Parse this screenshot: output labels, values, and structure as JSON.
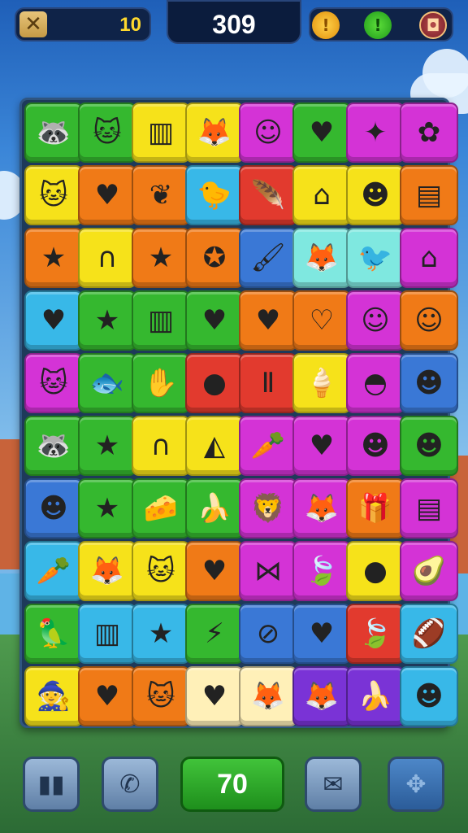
{
  "header": {
    "menu_icon": "crossed-tools-icon",
    "menu_glyph": "✕",
    "level": "10",
    "score": "309",
    "coin_glyph": "!",
    "hint_glyph": "!",
    "settings_glyph": "◘"
  },
  "board": {
    "tiles": [
      {
        "color": "#35b82f",
        "icon": "raccoon-face",
        "glyph": "🦝"
      },
      {
        "color": "#35b82f",
        "icon": "cat-face",
        "glyph": "🐱"
      },
      {
        "color": "#f6e21a",
        "icon": "striped-box",
        "glyph": "▥"
      },
      {
        "color": "#f6e21a",
        "icon": "fox-face",
        "glyph": "🦊"
      },
      {
        "color": "#d433d6",
        "icon": "ninja-face",
        "glyph": "☺"
      },
      {
        "color": "#35b82f",
        "icon": "heart",
        "glyph": "♥"
      },
      {
        "color": "#d433d6",
        "icon": "blue-square-stars",
        "glyph": "✦"
      },
      {
        "color": "#d433d6",
        "icon": "flower",
        "glyph": "✿"
      },
      {
        "color": "#f6e21a",
        "icon": "cat-face",
        "glyph": "🐱"
      },
      {
        "color": "#f07a17",
        "icon": "heart",
        "glyph": "♥"
      },
      {
        "color": "#f07a17",
        "icon": "leaf-heart",
        "glyph": "❦"
      },
      {
        "color": "#38b8e8",
        "icon": "yellow-chick",
        "glyph": "🐤"
      },
      {
        "color": "#e23a2e",
        "icon": "feather",
        "glyph": "🪶"
      },
      {
        "color": "#f6e21a",
        "icon": "teal-house",
        "glyph": "⌂"
      },
      {
        "color": "#f6e21a",
        "icon": "red-face",
        "glyph": "☻"
      },
      {
        "color": "#f07a17",
        "icon": "notebook",
        "glyph": "▤"
      },
      {
        "color": "#f07a17",
        "icon": "star",
        "glyph": "★"
      },
      {
        "color": "#f6e21a",
        "icon": "striped-arch",
        "glyph": "∩"
      },
      {
        "color": "#f07a17",
        "icon": "star",
        "glyph": "★"
      },
      {
        "color": "#f07a17",
        "icon": "blue-star",
        "glyph": "✪"
      },
      {
        "color": "#3a78d6",
        "icon": "paintbrush",
        "glyph": "🖌"
      },
      {
        "color": "#7fe8e0",
        "icon": "fox-face",
        "glyph": "🦊"
      },
      {
        "color": "#7fe8e0",
        "icon": "orange-bird",
        "glyph": "🐦"
      },
      {
        "color": "#d433d6",
        "icon": "teal-house",
        "glyph": "⌂"
      },
      {
        "color": "#38b8e8",
        "icon": "heart",
        "glyph": "♥"
      },
      {
        "color": "#35b82f",
        "icon": "star",
        "glyph": "★"
      },
      {
        "color": "#35b82f",
        "icon": "striped-box",
        "glyph": "▥"
      },
      {
        "color": "#35b82f",
        "icon": "heart",
        "glyph": "♥"
      },
      {
        "color": "#f07a17",
        "icon": "heart",
        "glyph": "♥"
      },
      {
        "color": "#f07a17",
        "icon": "yellow-heart",
        "glyph": "♡"
      },
      {
        "color": "#d433d6",
        "icon": "hat-face",
        "glyph": "☺"
      },
      {
        "color": "#f07a17",
        "icon": "hat-face",
        "glyph": "☺"
      },
      {
        "color": "#d433d6",
        "icon": "cat-face",
        "glyph": "🐱"
      },
      {
        "color": "#35b82f",
        "icon": "fish",
        "glyph": "🐟"
      },
      {
        "color": "#35b82f",
        "icon": "orange-hand",
        "glyph": "✋"
      },
      {
        "color": "#e23a2e",
        "icon": "purple-blob",
        "glyph": "●"
      },
      {
        "color": "#e23a2e",
        "icon": "letters",
        "glyph": "Ⅱ"
      },
      {
        "color": "#f6e21a",
        "icon": "ice-cream",
        "glyph": "🍦"
      },
      {
        "color": "#d433d6",
        "icon": "red-cap",
        "glyph": "◓"
      },
      {
        "color": "#3a78d6",
        "icon": "round-face",
        "glyph": "☻"
      },
      {
        "color": "#35b82f",
        "icon": "raccoon-face",
        "glyph": "🦝"
      },
      {
        "color": "#35b82f",
        "icon": "pink-star",
        "glyph": "★"
      },
      {
        "color": "#f6e21a",
        "icon": "striped-arch",
        "glyph": "∩"
      },
      {
        "color": "#f6e21a",
        "icon": "green-dome",
        "glyph": "◭"
      },
      {
        "color": "#d433d6",
        "icon": "carrot",
        "glyph": "🥕"
      },
      {
        "color": "#d433d6",
        "icon": "heart",
        "glyph": "♥"
      },
      {
        "color": "#d433d6",
        "icon": "yellow-face",
        "glyph": "☻"
      },
      {
        "color": "#35b82f",
        "icon": "orange-face",
        "glyph": "☻"
      },
      {
        "color": "#3a78d6",
        "icon": "red-face",
        "glyph": "☻"
      },
      {
        "color": "#35b82f",
        "icon": "purple-star",
        "glyph": "★"
      },
      {
        "color": "#35b82f",
        "icon": "cheese",
        "glyph": "🧀"
      },
      {
        "color": "#35b82f",
        "icon": "banana",
        "glyph": "🍌"
      },
      {
        "color": "#d433d6",
        "icon": "lion-face",
        "glyph": "🦁"
      },
      {
        "color": "#d433d6",
        "icon": "fox-face",
        "glyph": "🦊"
      },
      {
        "color": "#f07a17",
        "icon": "gift-box",
        "glyph": "🎁"
      },
      {
        "color": "#d433d6",
        "icon": "notepad",
        "glyph": "▤"
      },
      {
        "color": "#38b8e8",
        "icon": "carrot",
        "glyph": "🥕"
      },
      {
        "color": "#f6e21a",
        "icon": "fox-face",
        "glyph": "🦊"
      },
      {
        "color": "#f6e21a",
        "icon": "gray-cat",
        "glyph": "🐱"
      },
      {
        "color": "#f07a17",
        "icon": "heart",
        "glyph": "♥"
      },
      {
        "color": "#d433d6",
        "icon": "yellow-bowtie",
        "glyph": "⋈"
      },
      {
        "color": "#d433d6",
        "icon": "green-leaf",
        "glyph": "🍃"
      },
      {
        "color": "#f6e21a",
        "icon": "purple-blob",
        "glyph": "●"
      },
      {
        "color": "#d433d6",
        "icon": "avocado",
        "glyph": "🥑"
      },
      {
        "color": "#35b82f",
        "icon": "parrot",
        "glyph": "🦜"
      },
      {
        "color": "#38b8e8",
        "icon": "striped-box",
        "glyph": "▥"
      },
      {
        "color": "#38b8e8",
        "icon": "green-star",
        "glyph": "★"
      },
      {
        "color": "#35b82f",
        "icon": "lightning",
        "glyph": "⚡"
      },
      {
        "color": "#3a78d6",
        "icon": "compass",
        "glyph": "⊘"
      },
      {
        "color": "#3a78d6",
        "icon": "heart",
        "glyph": "♥"
      },
      {
        "color": "#e23a2e",
        "icon": "green-leaf",
        "glyph": "🍃"
      },
      {
        "color": "#38b8e8",
        "icon": "football",
        "glyph": "🏈"
      },
      {
        "color": "#f6e21a",
        "icon": "wizard-face",
        "glyph": "🧙"
      },
      {
        "color": "#f07a17",
        "icon": "heart",
        "glyph": "♥"
      },
      {
        "color": "#f07a17",
        "icon": "ghost-cat",
        "glyph": "🐱"
      },
      {
        "color": "#fff0b8",
        "icon": "heart",
        "glyph": "♥"
      },
      {
        "color": "#fff0b8",
        "icon": "fox-face",
        "glyph": "🦊"
      },
      {
        "color": "#7a33d6",
        "icon": "fox-face",
        "glyph": "🦊"
      },
      {
        "color": "#7a33d6",
        "icon": "bananas",
        "glyph": "🍌"
      },
      {
        "color": "#38b8e8",
        "icon": "turban-face",
        "glyph": "☻"
      }
    ]
  },
  "footer": {
    "stats_glyph": "▮▮",
    "call_glyph": "✆",
    "moves": "70",
    "chat_glyph": "✉",
    "map_glyph": "✥"
  }
}
